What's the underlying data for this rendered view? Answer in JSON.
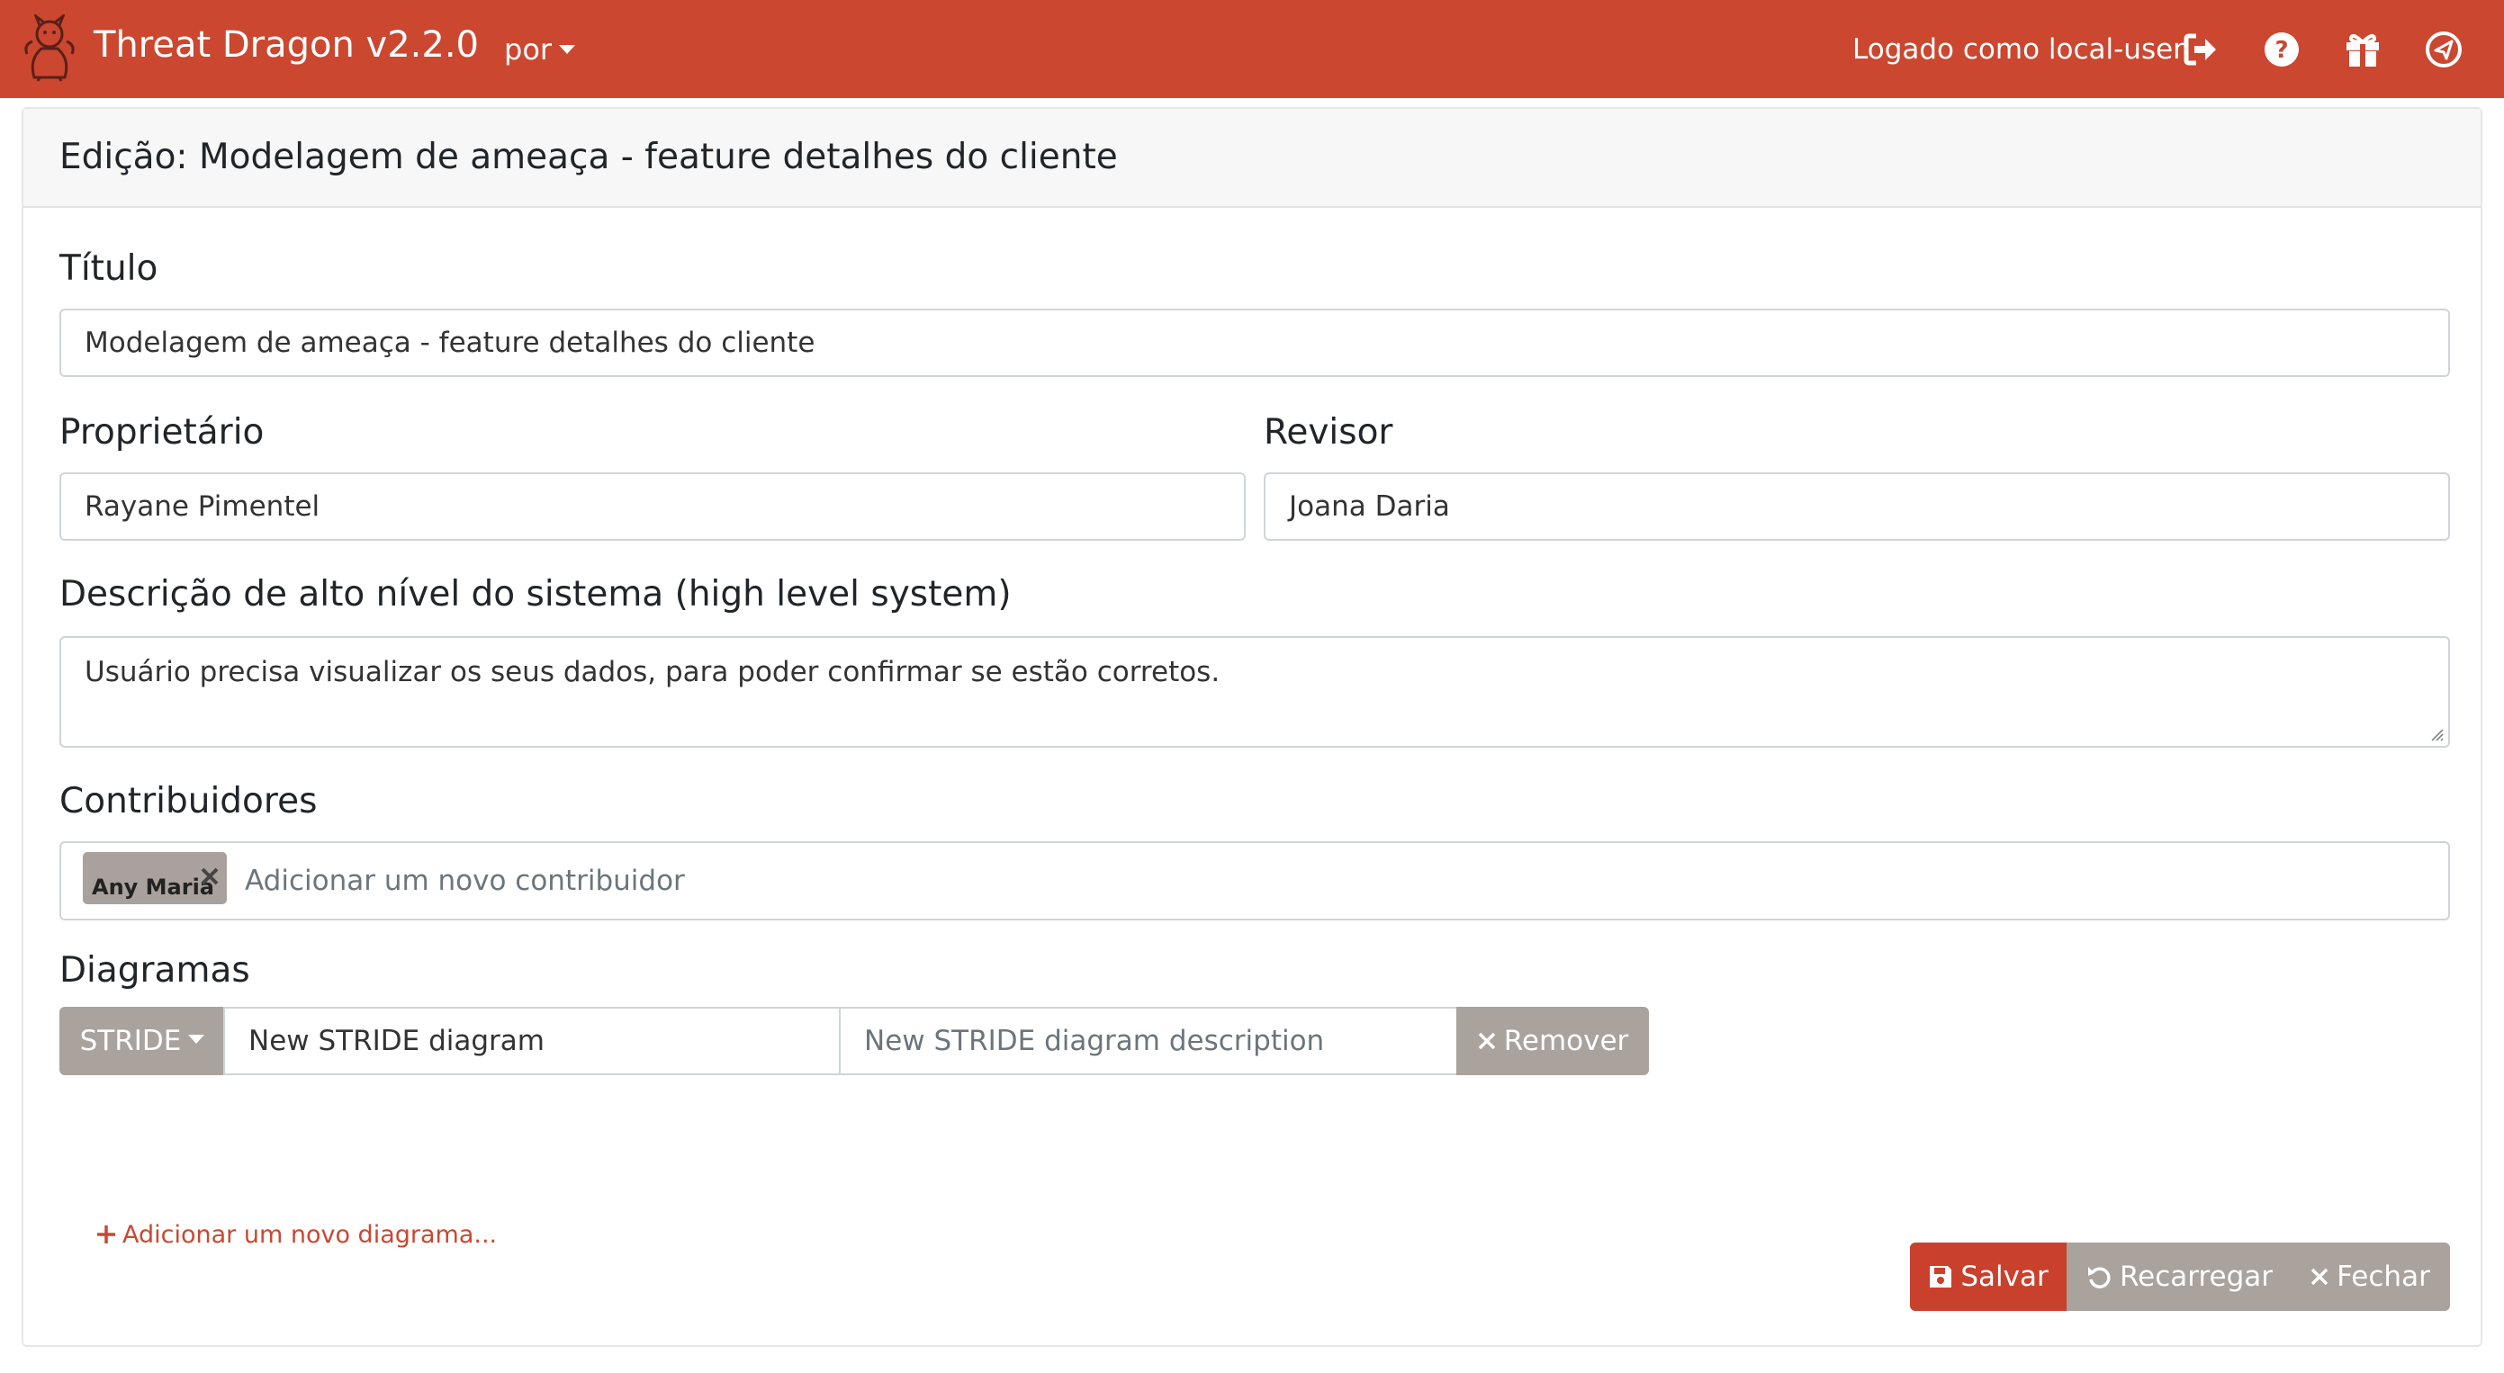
{
  "app": {
    "title": "Threat Dragon v2.2.0",
    "language": "por",
    "user_text": "Logado como local-user",
    "brand_color": "#cb4730"
  },
  "nav_icons": [
    "sign-out-icon",
    "question-icon",
    "gift-icon",
    "paper-plane-icon"
  ],
  "page": {
    "header": "Edição: Modelagem de ameaça - feature detalhes do cliente"
  },
  "form": {
    "title_label": "Título",
    "title_value": "Modelagem de ameaça - feature detalhes do cliente",
    "owner_label": "Proprietário",
    "owner_value": "Rayane Pimentel",
    "reviewer_label": "Revisor",
    "reviewer_value": "Joana Daria",
    "description_label": "Descrição de alto nível do sistema (high level system)",
    "description_value": "Usuário precisa visualizar os seus dados, para poder confirmar se estão corretos.",
    "contributors_label": "Contribuidores",
    "contributors": [
      "Any Maria"
    ],
    "contributor_placeholder": "Adicionar um novo contribuidor",
    "diagrams_label": "Diagramas",
    "diagrams": [
      {
        "type": "STRIDE",
        "title": "New STRIDE diagram",
        "description_placeholder": "New STRIDE diagram description",
        "remove_label": "Remover"
      }
    ],
    "add_diagram_label": "Adicionar um novo diagrama..."
  },
  "actions": {
    "save_label": "Salvar",
    "reload_label": "Recarregar",
    "close_label": "Fechar"
  }
}
